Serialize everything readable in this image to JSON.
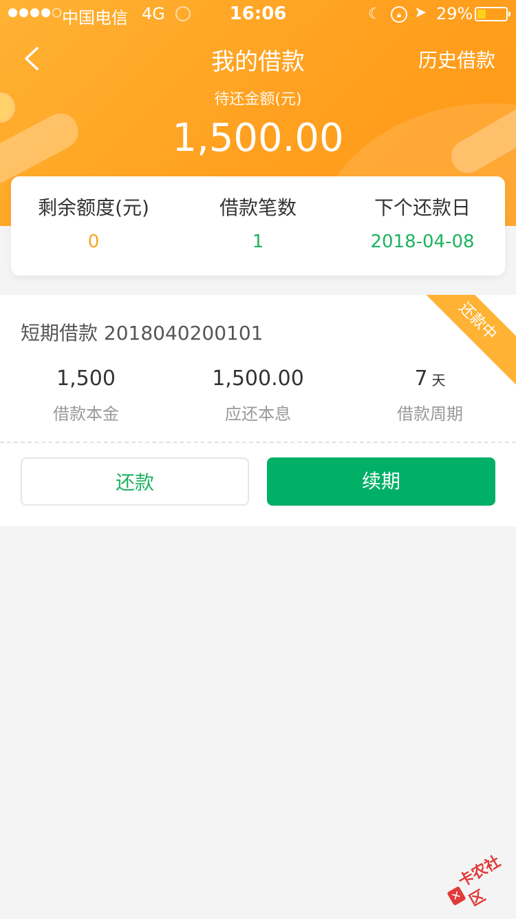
{
  "status_bar": {
    "carrier": "中国电信",
    "network": "4G",
    "time": "16:06",
    "battery_percent": "29%"
  },
  "nav": {
    "title": "我的借款",
    "history_link": "历史借款"
  },
  "due": {
    "label": "待还金额(元)",
    "amount": "1,500.00"
  },
  "summary": {
    "remaining_quota_label": "剩余额度(元)",
    "remaining_quota_value": "0",
    "loan_count_label": "借款笔数",
    "loan_count_value": "1",
    "next_due_label": "下个还款日",
    "next_due_value": "2018-04-08"
  },
  "loan": {
    "title": "短期借款 2018040200101",
    "status": "还款中",
    "principal_value": "1,500",
    "principal_label": "借款本金",
    "payable_value": "1,500.00",
    "payable_label": "应还本息",
    "period_value": "7",
    "period_unit": "天",
    "period_label": "借款周期",
    "repay_button": "还款",
    "renew_button": "续期"
  },
  "watermark": {
    "text": "卡农社区"
  },
  "colors": {
    "header_orange": "#ffa01f",
    "quota_orange": "#f5a623",
    "green": "#1db260",
    "button_green": "#00b066",
    "ribbon": "#ffb233"
  }
}
